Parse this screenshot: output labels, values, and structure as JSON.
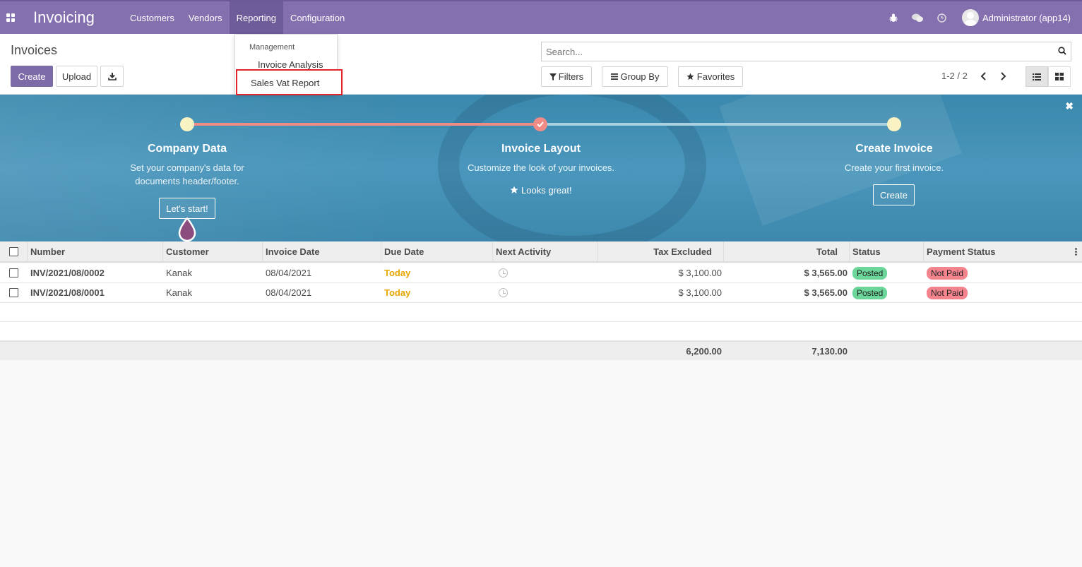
{
  "app": {
    "title": "Invoicing"
  },
  "menu": [
    {
      "label": "Customers"
    },
    {
      "label": "Vendors"
    },
    {
      "label": "Reporting"
    },
    {
      "label": "Configuration"
    }
  ],
  "user": {
    "name": "Administrator (app14)"
  },
  "dropdown": {
    "header": "Management",
    "items": [
      {
        "label": "Invoice Analysis"
      },
      {
        "label": "Sales Vat Report"
      }
    ]
  },
  "control_panel": {
    "breadcrumb": "Invoices",
    "create_label": "Create",
    "upload_label": "Upload",
    "search_placeholder": "Search...",
    "filters_label": "Filters",
    "groupby_label": "Group By",
    "favorites_label": "Favorites",
    "pager": "1-2 / 2"
  },
  "banner": {
    "steps": [
      {
        "title": "Company Data",
        "desc1": "Set your company's data for",
        "desc2": "documents header/footer.",
        "button": "Let's start!"
      },
      {
        "title": "Invoice Layout",
        "desc1": "Customize the look of your invoices.",
        "done_text": "Looks great!"
      },
      {
        "title": "Create Invoice",
        "desc1": "Create your first invoice.",
        "button": "Create"
      }
    ]
  },
  "table": {
    "columns": [
      "Number",
      "Customer",
      "Invoice Date",
      "Due Date",
      "Next Activity",
      "Tax Excluded",
      "Total",
      "Status",
      "Payment Status"
    ],
    "rows": [
      {
        "number": "INV/2021/08/0002",
        "customer": "Kanak",
        "invoice_date": "08/04/2021",
        "due_date": "Today",
        "tax_excluded": "$ 3,100.00",
        "total": "$ 3,565.00",
        "status": "Posted",
        "payment_status": "Not Paid"
      },
      {
        "number": "INV/2021/08/0001",
        "customer": "Kanak",
        "invoice_date": "08/04/2021",
        "due_date": "Today",
        "tax_excluded": "$ 3,100.00",
        "total": "$ 3,565.00",
        "status": "Posted",
        "payment_status": "Not Paid"
      }
    ],
    "totals": {
      "tax_excluded": "6,200.00",
      "total": "7,130.00"
    }
  },
  "colors": {
    "nav": "#8470ae",
    "primary": "#7c6ba7",
    "posted": "#6cd69a",
    "not_paid": "#f3848e",
    "today": "#e6a700"
  }
}
